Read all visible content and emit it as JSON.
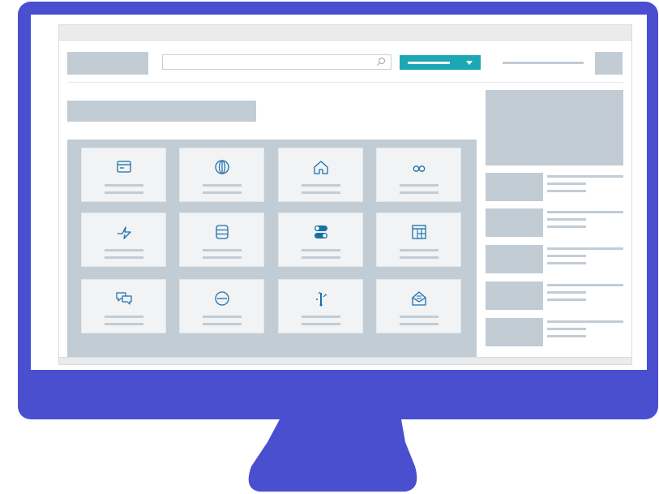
{
  "colors": {
    "monitor_frame": "#4a4fd0",
    "accent": "#1ba8b4",
    "placeholder_gray": "#c2ccd5",
    "tile_bg": "#f1f3f5",
    "icon_blue": "#1b6fa8"
  },
  "header": {
    "search": {
      "placeholder": "",
      "icon": "search-icon"
    },
    "dropdown": {
      "selected": "",
      "icon": "chevron-down-icon"
    },
    "user_name": ""
  },
  "main": {
    "title": "",
    "tiles": [
      {
        "icon": "credit-card-icon",
        "label": "",
        "sublabel": ""
      },
      {
        "icon": "globe-icon",
        "label": "",
        "sublabel": ""
      },
      {
        "icon": "home-icon",
        "label": "",
        "sublabel": ""
      },
      {
        "icon": "infinity-icon",
        "label": "",
        "sublabel": ""
      },
      {
        "icon": "lightning-icon",
        "label": "",
        "sublabel": ""
      },
      {
        "icon": "database-icon",
        "label": "",
        "sublabel": ""
      },
      {
        "icon": "toggle-icon",
        "label": "",
        "sublabel": ""
      },
      {
        "icon": "table-icon",
        "label": "",
        "sublabel": ""
      },
      {
        "icon": "chat-icon",
        "label": "",
        "sublabel": ""
      },
      {
        "icon": "minus-circle-icon",
        "label": "",
        "sublabel": ""
      },
      {
        "icon": "tools-icon",
        "label": "",
        "sublabel": ""
      },
      {
        "icon": "open-mail-icon",
        "label": "",
        "sublabel": ""
      }
    ]
  },
  "sidebar": {
    "items": [
      {
        "title": "",
        "line1": "",
        "line2": ""
      },
      {
        "title": "",
        "line1": "",
        "line2": ""
      },
      {
        "title": "",
        "line1": "",
        "line2": ""
      },
      {
        "title": "",
        "line1": "",
        "line2": ""
      },
      {
        "title": "",
        "line1": "",
        "line2": ""
      }
    ]
  }
}
